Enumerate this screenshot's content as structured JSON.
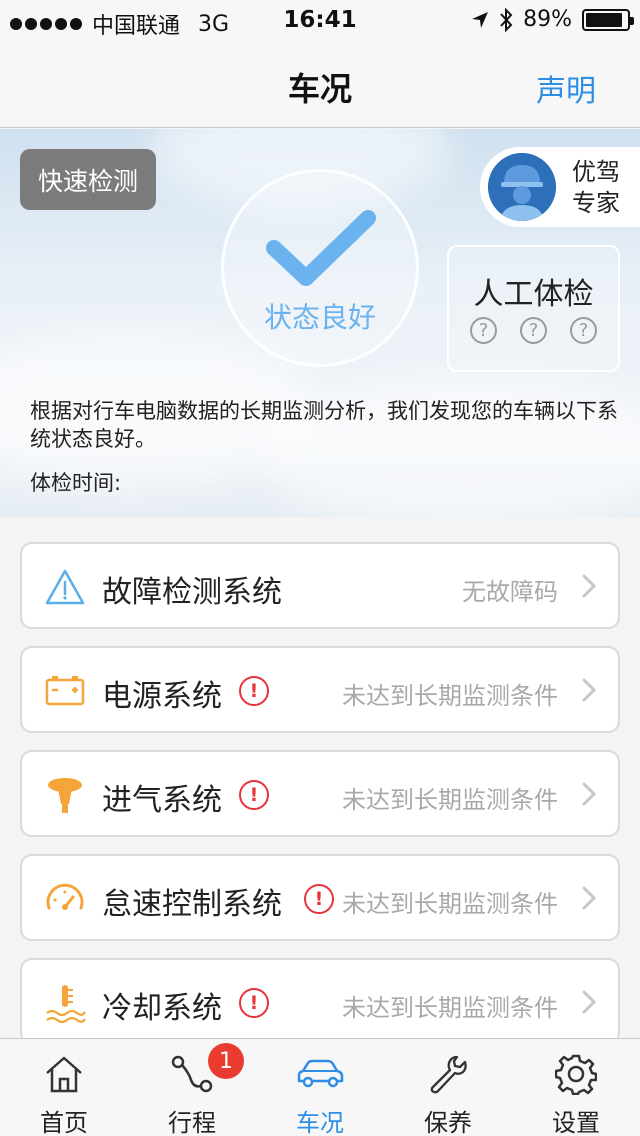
{
  "status_bar": {
    "carrier": "中国联通",
    "network": "3G",
    "time": "16:41",
    "battery": "89%",
    "battery_level": 0.89
  },
  "navbar": {
    "title": "车况",
    "action_label": "声明"
  },
  "hero": {
    "quick_check_label": "快速检测",
    "status_label": "状态良好",
    "expert_label": "优驾专家",
    "manual_check_label": "人工体检",
    "manual_question_marks": [
      "?",
      "?",
      "?"
    ],
    "description": "根据对行车电脑数据的长期监测分析，我们发现您的车辆以下系统状态良好。",
    "check_time_label": "体检时间:"
  },
  "systems": [
    {
      "name": "故障检测系统",
      "icon": "warning-triangle-icon",
      "value": "无故障码",
      "alert": false
    },
    {
      "name": "电源系统",
      "icon": "battery-icon",
      "value": "未达到长期监测条件",
      "alert": true
    },
    {
      "name": "进气系统",
      "icon": "air-intake-icon",
      "value": "未达到长期监测条件",
      "alert": true
    },
    {
      "name": "怠速控制系统",
      "icon": "speedometer-icon",
      "value": "未达到长期监测条件",
      "alert": true
    },
    {
      "name": "冷却系统",
      "icon": "coolant-temperature-icon",
      "value": "未达到长期监测条件",
      "alert": true
    }
  ],
  "alert_symbol": "!",
  "tabbar": {
    "tabs": [
      {
        "label": "首页",
        "icon": "home-icon"
      },
      {
        "label": "行程",
        "icon": "route-icon",
        "badge": "1"
      },
      {
        "label": "车况",
        "icon": "car-icon",
        "active": true
      },
      {
        "label": "保养",
        "icon": "wrench-icon"
      },
      {
        "label": "设置",
        "icon": "gear-icon"
      }
    ]
  },
  "colors": {
    "accent_blue": "#2e8ee6",
    "check_blue": "#6ab3ef",
    "icon_orange": "#f5a43a",
    "alert_red": "#e8333a"
  }
}
